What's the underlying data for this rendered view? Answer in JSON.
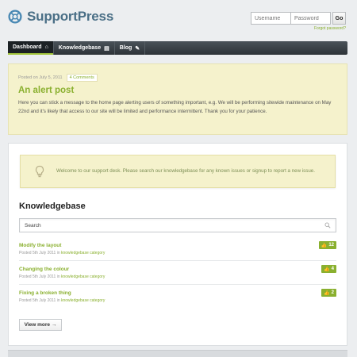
{
  "brand": {
    "name": "SupportPress"
  },
  "login": {
    "username_placeholder": "Username",
    "password_placeholder": "Password",
    "go_label": "Go",
    "forgot_label": "Forgot password?"
  },
  "nav": {
    "items": [
      {
        "label": "Dashboard",
        "icon": "home-icon",
        "glyph": "⌂"
      },
      {
        "label": "Knowledgebase",
        "icon": "book-icon",
        "glyph": "▤"
      },
      {
        "label": "Blog",
        "icon": "pencil-icon",
        "glyph": "✎"
      }
    ]
  },
  "alert_post": {
    "date": "Posted on July 5, 2011",
    "comments": "4 Comments",
    "title": "An alert post",
    "body": "Here you can stick a message to the home page alerting users of something important, e.g. We will be performing sitewide maintenance on May 22nd and it's likely that access to our site will be limited and performance intermittent. Thank you for your patience."
  },
  "welcome": {
    "text": "Welcome to our support desk. Please search our knowledgebase for any known issues or signup to report a new issue."
  },
  "knowledgebase": {
    "title": "Knowledgebase",
    "search_placeholder": "Search",
    "items": [
      {
        "title": "Modify the layout",
        "meta_prefix": "Posted 5th July 2011 in ",
        "category": "knowledgebase category",
        "votes": "12"
      },
      {
        "title": "Changing the colour",
        "meta_prefix": "Posted 5th July 2011 in ",
        "category": "knowledgebase category",
        "votes": "4"
      },
      {
        "title": "Fixing a broken thing",
        "meta_prefix": "Posted 5th July 2011 in ",
        "category": "knowledgebase category",
        "votes": "2"
      }
    ],
    "view_more": "View more →"
  },
  "colors": {
    "accent": "#8ab02f",
    "brand": "#4a6f86",
    "alert_bg": "#f5f2cc",
    "nav_bg": "#2d3338"
  }
}
